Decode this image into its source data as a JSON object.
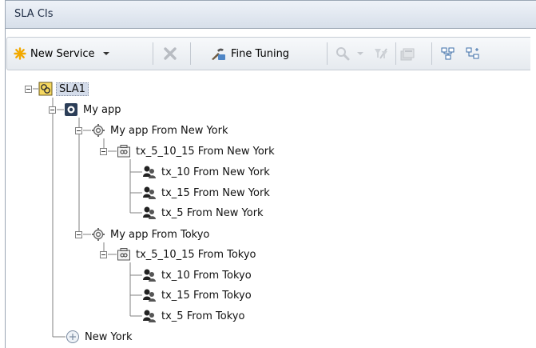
{
  "panel": {
    "title": "SLA CIs"
  },
  "toolbar": {
    "new_service_label": "New Service",
    "fine_tuning_label": "Fine Tuning"
  },
  "tree": {
    "root": "SLA1",
    "app": "My app",
    "ny_group": "My app From New York",
    "ny_tx_group": "tx_5_10_15 From New York",
    "ny_tx10": "tx_10 From New York",
    "ny_tx15": "tx_15 From New York",
    "ny_tx5": "tx_5 From New York",
    "tokyo_group": "My app From Tokyo",
    "tokyo_tx_group": "tx_5_10_15 From Tokyo",
    "tokyo_tx10": "tx_10 From Tokyo",
    "tokyo_tx15": "tx_15 From Tokyo",
    "tokyo_tx5": "tx_5 From Tokyo",
    "location": "New York"
  }
}
